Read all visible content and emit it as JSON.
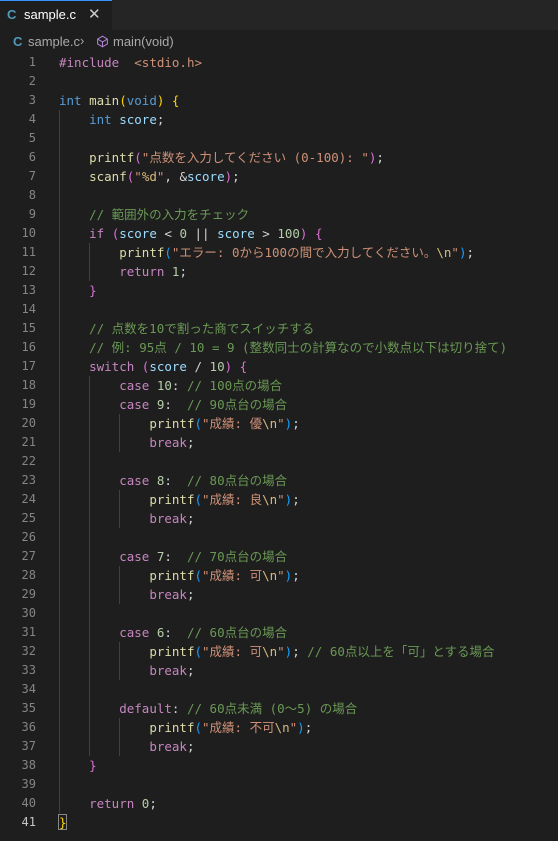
{
  "tab": {
    "icon": "C",
    "label": "sample.c",
    "close": "✕"
  },
  "breadcrumb": {
    "lang_icon": "C",
    "file": "sample.c",
    "separator": "›",
    "symbol_icon": "symbol-method-icon",
    "function": "main(void)"
  },
  "active_line": 41,
  "lines": [
    {
      "n": "1",
      "t": [
        [
          "ctl",
          "#include"
        ],
        [
          "",
          "  "
        ],
        [
          "str",
          "<stdio.h>"
        ]
      ]
    },
    {
      "n": "2",
      "t": []
    },
    {
      "n": "3",
      "t": [
        [
          "kw",
          "int"
        ],
        [
          "",
          " "
        ],
        [
          "fn",
          "main"
        ],
        [
          "br1",
          "("
        ],
        [
          "kw",
          "void"
        ],
        [
          "br1",
          ")"
        ],
        [
          "",
          " "
        ],
        [
          "br1",
          "{"
        ]
      ]
    },
    {
      "n": "4",
      "t": [
        [
          "",
          "    "
        ],
        [
          "kw",
          "int"
        ],
        [
          "",
          " "
        ],
        [
          "var",
          "score"
        ],
        [
          "",
          ";"
        ]
      ]
    },
    {
      "n": "5",
      "t": []
    },
    {
      "n": "6",
      "t": [
        [
          "",
          "    "
        ],
        [
          "fn",
          "printf"
        ],
        [
          "br2",
          "("
        ],
        [
          "str",
          "\"点数を入力してください (0-100): \""
        ],
        [
          "br2",
          ")"
        ],
        [
          "",
          ";"
        ]
      ]
    },
    {
      "n": "7",
      "t": [
        [
          "",
          "    "
        ],
        [
          "fn",
          "scanf"
        ],
        [
          "br2",
          "("
        ],
        [
          "str",
          "\""
        ],
        [
          "esc",
          "%d"
        ],
        [
          "str",
          "\""
        ],
        [
          "",
          ", &"
        ],
        [
          "var",
          "score"
        ],
        [
          "br2",
          ")"
        ],
        [
          "",
          ";"
        ]
      ]
    },
    {
      "n": "8",
      "t": []
    },
    {
      "n": "9",
      "t": [
        [
          "",
          "    "
        ],
        [
          "cmt",
          "// 範囲外の入力をチェック"
        ]
      ]
    },
    {
      "n": "10",
      "t": [
        [
          "",
          "    "
        ],
        [
          "ctl",
          "if"
        ],
        [
          "",
          " "
        ],
        [
          "br2",
          "("
        ],
        [
          "var",
          "score"
        ],
        [
          "",
          " < "
        ],
        [
          "num",
          "0"
        ],
        [
          "",
          " || "
        ],
        [
          "var",
          "score"
        ],
        [
          "",
          " > "
        ],
        [
          "num",
          "100"
        ],
        [
          "br2",
          ")"
        ],
        [
          "",
          " "
        ],
        [
          "br2",
          "{"
        ]
      ]
    },
    {
      "n": "11",
      "t": [
        [
          "",
          "        "
        ],
        [
          "fn",
          "printf"
        ],
        [
          "br3",
          "("
        ],
        [
          "str",
          "\"エラー: 0から100の間で入力してください。"
        ],
        [
          "esc",
          "\\n"
        ],
        [
          "str",
          "\""
        ],
        [
          "br3",
          ")"
        ],
        [
          "",
          ";"
        ]
      ]
    },
    {
      "n": "12",
      "t": [
        [
          "",
          "        "
        ],
        [
          "ctl",
          "return"
        ],
        [
          "",
          " "
        ],
        [
          "num",
          "1"
        ],
        [
          "",
          ";"
        ]
      ]
    },
    {
      "n": "13",
      "t": [
        [
          "",
          "    "
        ],
        [
          "br2",
          "}"
        ]
      ]
    },
    {
      "n": "14",
      "t": []
    },
    {
      "n": "15",
      "t": [
        [
          "",
          "    "
        ],
        [
          "cmt",
          "// 点数を10で割った商でスイッチする"
        ]
      ]
    },
    {
      "n": "16",
      "t": [
        [
          "",
          "    "
        ],
        [
          "cmt",
          "// 例: 95点 / 10 = 9 (整数同士の計算なので小数点以下は切り捨て)"
        ]
      ]
    },
    {
      "n": "17",
      "t": [
        [
          "",
          "    "
        ],
        [
          "ctl",
          "switch"
        ],
        [
          "",
          " "
        ],
        [
          "br2",
          "("
        ],
        [
          "var",
          "score"
        ],
        [
          "",
          " / "
        ],
        [
          "num",
          "10"
        ],
        [
          "br2",
          ")"
        ],
        [
          "",
          " "
        ],
        [
          "br2",
          "{"
        ]
      ]
    },
    {
      "n": "18",
      "t": [
        [
          "",
          "        "
        ],
        [
          "ctl",
          "case"
        ],
        [
          "",
          " "
        ],
        [
          "num",
          "10"
        ],
        [
          "",
          ": "
        ],
        [
          "cmt",
          "// 100点の場合"
        ]
      ]
    },
    {
      "n": "19",
      "t": [
        [
          "",
          "        "
        ],
        [
          "ctl",
          "case"
        ],
        [
          "",
          " "
        ],
        [
          "num",
          "9"
        ],
        [
          "",
          ":  "
        ],
        [
          "cmt",
          "// 90点台の場合"
        ]
      ]
    },
    {
      "n": "20",
      "t": [
        [
          "",
          "            "
        ],
        [
          "fn",
          "printf"
        ],
        [
          "br3",
          "("
        ],
        [
          "str",
          "\"成績: 優"
        ],
        [
          "esc",
          "\\n"
        ],
        [
          "str",
          "\""
        ],
        [
          "br3",
          ")"
        ],
        [
          "",
          ";"
        ]
      ]
    },
    {
      "n": "21",
      "t": [
        [
          "",
          "            "
        ],
        [
          "ctl",
          "break"
        ],
        [
          "",
          ";"
        ]
      ]
    },
    {
      "n": "22",
      "t": []
    },
    {
      "n": "23",
      "t": [
        [
          "",
          "        "
        ],
        [
          "ctl",
          "case"
        ],
        [
          "",
          " "
        ],
        [
          "num",
          "8"
        ],
        [
          "",
          ":  "
        ],
        [
          "cmt",
          "// 80点台の場合"
        ]
      ]
    },
    {
      "n": "24",
      "t": [
        [
          "",
          "            "
        ],
        [
          "fn",
          "printf"
        ],
        [
          "br3",
          "("
        ],
        [
          "str",
          "\"成績: 良"
        ],
        [
          "esc",
          "\\n"
        ],
        [
          "str",
          "\""
        ],
        [
          "br3",
          ")"
        ],
        [
          "",
          ";"
        ]
      ]
    },
    {
      "n": "25",
      "t": [
        [
          "",
          "            "
        ],
        [
          "ctl",
          "break"
        ],
        [
          "",
          ";"
        ]
      ]
    },
    {
      "n": "26",
      "t": []
    },
    {
      "n": "27",
      "t": [
        [
          "",
          "        "
        ],
        [
          "ctl",
          "case"
        ],
        [
          "",
          " "
        ],
        [
          "num",
          "7"
        ],
        [
          "",
          ":  "
        ],
        [
          "cmt",
          "// 70点台の場合"
        ]
      ]
    },
    {
      "n": "28",
      "t": [
        [
          "",
          "            "
        ],
        [
          "fn",
          "printf"
        ],
        [
          "br3",
          "("
        ],
        [
          "str",
          "\"成績: 可"
        ],
        [
          "esc",
          "\\n"
        ],
        [
          "str",
          "\""
        ],
        [
          "br3",
          ")"
        ],
        [
          "",
          ";"
        ]
      ]
    },
    {
      "n": "29",
      "t": [
        [
          "",
          "            "
        ],
        [
          "ctl",
          "break"
        ],
        [
          "",
          ";"
        ]
      ]
    },
    {
      "n": "30",
      "t": []
    },
    {
      "n": "31",
      "t": [
        [
          "",
          "        "
        ],
        [
          "ctl",
          "case"
        ],
        [
          "",
          " "
        ],
        [
          "num",
          "6"
        ],
        [
          "",
          ":  "
        ],
        [
          "cmt",
          "// 60点台の場合"
        ]
      ]
    },
    {
      "n": "32",
      "t": [
        [
          "",
          "            "
        ],
        [
          "fn",
          "printf"
        ],
        [
          "br3",
          "("
        ],
        [
          "str",
          "\"成績: 可"
        ],
        [
          "esc",
          "\\n"
        ],
        [
          "str",
          "\""
        ],
        [
          "br3",
          ")"
        ],
        [
          "",
          "; "
        ],
        [
          "cmt",
          "// 60点以上を「可」とする場合"
        ]
      ]
    },
    {
      "n": "33",
      "t": [
        [
          "",
          "            "
        ],
        [
          "ctl",
          "break"
        ],
        [
          "",
          ";"
        ]
      ]
    },
    {
      "n": "34",
      "t": []
    },
    {
      "n": "35",
      "t": [
        [
          "",
          "        "
        ],
        [
          "ctl",
          "default"
        ],
        [
          "",
          ": "
        ],
        [
          "cmt",
          "// 60点未満 (0〜5) の場合"
        ]
      ]
    },
    {
      "n": "36",
      "t": [
        [
          "",
          "            "
        ],
        [
          "fn",
          "printf"
        ],
        [
          "br3",
          "("
        ],
        [
          "str",
          "\"成績: 不可"
        ],
        [
          "esc",
          "\\n"
        ],
        [
          "str",
          "\""
        ],
        [
          "br3",
          ")"
        ],
        [
          "",
          ";"
        ]
      ]
    },
    {
      "n": "37",
      "t": [
        [
          "",
          "            "
        ],
        [
          "ctl",
          "break"
        ],
        [
          "",
          ";"
        ]
      ]
    },
    {
      "n": "38",
      "t": [
        [
          "",
          "    "
        ],
        [
          "br2",
          "}"
        ]
      ]
    },
    {
      "n": "39",
      "t": []
    },
    {
      "n": "40",
      "t": [
        [
          "",
          "    "
        ],
        [
          "ctl",
          "return"
        ],
        [
          "",
          " "
        ],
        [
          "num",
          "0"
        ],
        [
          "",
          ";"
        ]
      ]
    },
    {
      "n": "41",
      "t": [
        [
          "br1",
          "}"
        ]
      ]
    }
  ]
}
